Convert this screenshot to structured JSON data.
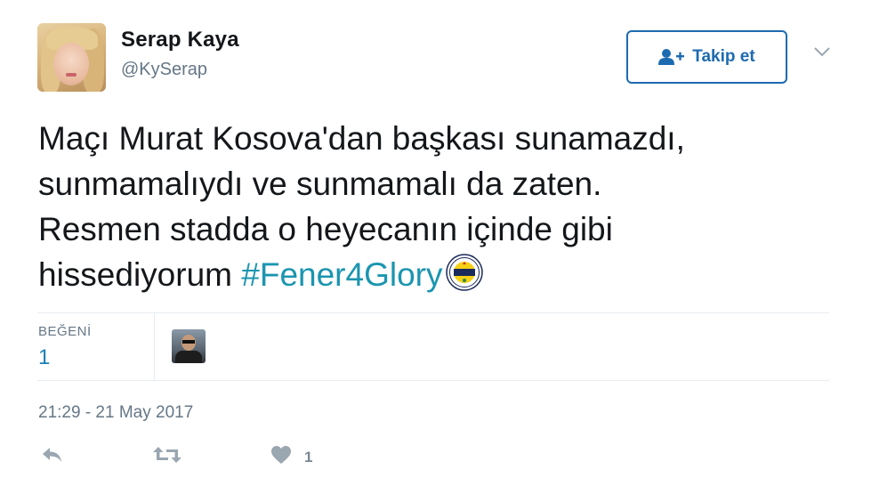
{
  "user": {
    "name": "Serap Kaya",
    "handle": "@KySerap",
    "avatar_icon": "profile-photo"
  },
  "follow_button": {
    "label": "Takip et",
    "icon": "follow-user-icon",
    "color": "#1c6bb1"
  },
  "more_menu_icon": "chevron-down-icon",
  "tweet": {
    "lines": [
      "Maçı Murat Kosova'dan başkası sunamazdı,",
      "sunmamalıydı ve sunmamalı da zaten.",
      "Resmen stadda o heyecanın içinde gibi"
    ],
    "last_line_text": "hissediyorum",
    "hashtag": "#Fener4Glory",
    "hashtag_emoji": "fenerbahce-emblem",
    "hashtag_color": "#1b95b0"
  },
  "stats": {
    "likes_label": "BEĞENİ",
    "likes_count": "1",
    "likers": [
      "liker-avatar"
    ]
  },
  "timestamp": "21:29 - 21 May 2017",
  "actions": {
    "reply_icon": "reply-icon",
    "retweet_icon": "retweet-icon",
    "like_icon": "heart-icon",
    "like_count": "1"
  }
}
